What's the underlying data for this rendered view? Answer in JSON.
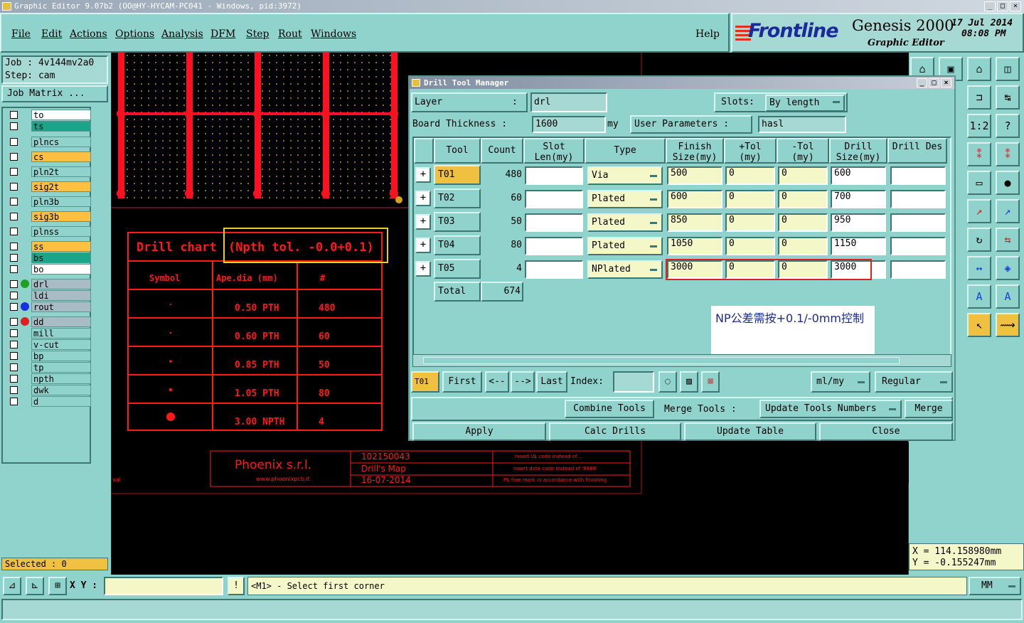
{
  "window": {
    "title": "Graphic Editor 9.07b2 (OO@HY-HYCAM-PC041 - Windows, pid:3972)"
  },
  "menu": [
    "File",
    "Edit",
    "Actions",
    "Options",
    "Analysis",
    "DFM",
    "Step",
    "Rout",
    "Windows"
  ],
  "help_label": "Help",
  "brand": {
    "logo": "Frontline",
    "product": "Genesis 2000",
    "subtitle": "Graphic Editor",
    "date": "17 Jul 2014",
    "time": "08:08 PM"
  },
  "job": {
    "job_label": "Job : 4v144mv2a0",
    "step_label": "Step: cam",
    "matrix_button": "Job Matrix ..."
  },
  "layers": [
    {
      "name": "to",
      "color": "#ffffff"
    },
    {
      "name": "ts",
      "color": "#1aa58a"
    },
    {
      "name": "plncs",
      "color": "#8fd3cc"
    },
    {
      "name": "cs",
      "color": "#ffbf40"
    },
    {
      "name": "pln2t",
      "color": "#8fd3cc"
    },
    {
      "name": "sig2t",
      "color": "#ffbf40"
    },
    {
      "name": "pln3b",
      "color": "#8fd3cc"
    },
    {
      "name": "sig3b",
      "color": "#ffbf40"
    },
    {
      "name": "plnss",
      "color": "#8fd3cc"
    },
    {
      "name": "ss",
      "color": "#ffbf40"
    },
    {
      "name": "bs",
      "color": "#1aa58a"
    },
    {
      "name": "bo",
      "color": "#ffffff"
    },
    {
      "name": "drl",
      "color": "#a7bcc4"
    },
    {
      "name": "ldi",
      "color": "#a7bcc4"
    },
    {
      "name": "rout",
      "color": "#a7bcc4"
    },
    {
      "name": "dd",
      "color": "#a7bcc4"
    },
    {
      "name": "mill",
      "color": "#8fd3cc"
    },
    {
      "name": "v-cut",
      "color": "#8fd3cc"
    },
    {
      "name": "bp",
      "color": "#8fd3cc"
    },
    {
      "name": "tp",
      "color": "#8fd3cc"
    },
    {
      "name": "npth",
      "color": "#8fd3cc"
    },
    {
      "name": "dwk",
      "color": "#8fd3cc"
    },
    {
      "name": "d",
      "color": "#8fd3cc"
    }
  ],
  "selected_label": "Selected : 0",
  "drill_chart": {
    "title": "Drill chart",
    "note": "(Npth tol. -0.0+0.1)",
    "headers": [
      "Symbol",
      "Ape.dia (mm)",
      "#"
    ],
    "rows": [
      {
        "dia": "0.50 PTH",
        "count": "480"
      },
      {
        "dia": "0.60 PTH",
        "count": "60"
      },
      {
        "dia": "0.85 PTH",
        "count": "50"
      },
      {
        "dia": "1.05 PTH",
        "count": "80"
      },
      {
        "dia": "3.00 NPTH",
        "count": "4"
      }
    ]
  },
  "title_block": {
    "company": "Phoenix s.r.l.",
    "website": "www.phoenixpcb.it",
    "code": "102150043",
    "map": "Drill's Map",
    "date": "16-07-2014",
    "note1": "Insert UL code instead of ...",
    "note2": "Insert date code instead of '8888'",
    "note3": "Pb free mark in accordance with finishing",
    "left_text": "val"
  },
  "dialog": {
    "title": "Drill Tool Manager",
    "layer_label": "Layer",
    "layer_value": "drl",
    "slots_label": "Slots:",
    "slots_value": "By length",
    "thickness_label": "Board Thickness :",
    "thickness_value": "1600",
    "thickness_unit": "my",
    "user_params_label": "User Parameters :",
    "user_params_value": "hasl",
    "headers": {
      "tool": "Tool",
      "count": "Count",
      "slot": "Slot Len(my)",
      "type": "Type",
      "finish": "Finish Size(my)",
      "ptol": "+Tol (my)",
      "mtol": "-Tol (my)",
      "drill": "Drill Size(my)",
      "des": "Drill Des"
    },
    "rows": [
      {
        "tool": "T01",
        "count": "480",
        "type": "Via",
        "finish": "500",
        "ptol": "0",
        "mtol": "0",
        "drill": "600"
      },
      {
        "tool": "T02",
        "count": "60",
        "type": "Plated",
        "finish": "600",
        "ptol": "0",
        "mtol": "0",
        "drill": "700"
      },
      {
        "tool": "T03",
        "count": "50",
        "type": "Plated",
        "finish": "850",
        "ptol": "0",
        "mtol": "0",
        "drill": "950"
      },
      {
        "tool": "T04",
        "count": "80",
        "type": "Plated",
        "finish": "1050",
        "ptol": "0",
        "mtol": "0",
        "drill": "1150"
      },
      {
        "tool": "T05",
        "count": "4",
        "type": "NPlated",
        "finish": "3000",
        "ptol": "0",
        "mtol": "0",
        "drill": "3000"
      }
    ],
    "total_label": "Total",
    "total_value": "674",
    "annotation": "NP公差需按+0.1/-0mm控制",
    "nav": {
      "current": "T01",
      "first": "First",
      "prev": "<--",
      "next": "-->",
      "last": "Last",
      "index_label": "Index:",
      "units": "ml/my",
      "mode": "Regular"
    },
    "combine_tools": "Combine Tools",
    "merge_tools_label": "Merge Tools :",
    "merge_tools_value": "Update Tools Numbers",
    "merge_button": "Merge",
    "apply": "Apply",
    "calc": "Calc Drills",
    "update": "Update Table",
    "close": "Close"
  },
  "coords": {
    "x": "X  =  114.158980mm",
    "y": "Y  =  -0.155247mm"
  },
  "bottom": {
    "xy_label": "X Y :",
    "status": "<M1> - Select first corner",
    "units": "MM"
  }
}
